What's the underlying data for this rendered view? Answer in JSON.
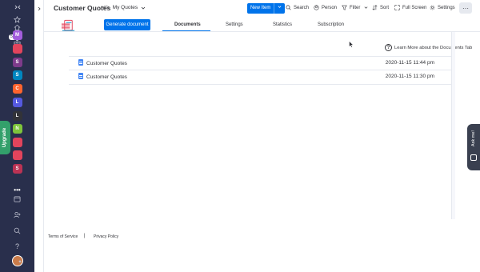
{
  "app": {
    "board_title": "Customer Quotes",
    "view_name": "My Quotes",
    "notification_badge": "500+",
    "upgrade_label": "Upgrade"
  },
  "workspaces": [
    {
      "letter": "M",
      "color": "#a25ddc"
    },
    {
      "letter": "",
      "color": "#e2445c"
    },
    {
      "letter": "S",
      "color": "#7e3b8a"
    },
    {
      "letter": "S",
      "color": "#0086c0"
    },
    {
      "letter": "C",
      "color": "#ff642e"
    },
    {
      "letter": "L",
      "color": "#5559df"
    },
    {
      "letter": "L",
      "color": "#323338"
    },
    {
      "letter": "N",
      "color": "#7ec43b"
    },
    {
      "letter": "",
      "color": "#e2445c"
    },
    {
      "letter": "",
      "color": "#e2445c"
    },
    {
      "letter": "S",
      "color": "#bb3354"
    }
  ],
  "toolbar": {
    "new_item": "New Item",
    "search": "Search",
    "person": "Person",
    "filter": "Filter",
    "sort": "Sort",
    "full_screen": "Full Screen",
    "settings": "Settings",
    "more": "···"
  },
  "app_view": {
    "generate_button": "Generate document",
    "tabs": [
      "Documents",
      "Settings",
      "Statistics",
      "Subscription"
    ],
    "active_tab": "Documents",
    "help_link": "Learn More about the Documents Tab"
  },
  "documents": [
    {
      "name": "Customer Quotes",
      "date": "2020-11-15 11:44 pm"
    },
    {
      "name": "Customer Quotes",
      "date": "2020-11-15 11:30 pm"
    }
  ],
  "footer": {
    "terms": "Terms of Service",
    "separator": "|",
    "privacy": "Privacy Policy"
  },
  "ask_me": "Ask me!",
  "colors": {
    "sidebar": "#292f4c",
    "accent": "#0073ea",
    "upgrade": "#33a06b"
  }
}
